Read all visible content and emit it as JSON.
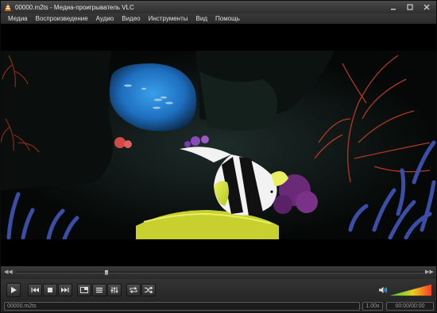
{
  "window": {
    "title": "00000.m2ts - Медиа-проигрыватель VLC",
    "controls": {
      "minimize_icon": "minimize-icon",
      "maximize_icon": "maximize-icon",
      "close_icon": "close-icon"
    }
  },
  "menu": {
    "items": [
      "Медиа",
      "Воспроизведение",
      "Аудио",
      "Видео",
      "Инструменты",
      "Вид",
      "Помощь"
    ]
  },
  "video": {
    "description_icon": "video-frame"
  },
  "seek": {
    "position": 0.22
  },
  "controls": {
    "buttons": [
      {
        "name": "play",
        "icon": "play-icon"
      },
      {
        "name": "previous",
        "icon": "previous-icon"
      },
      {
        "name": "stop",
        "icon": "stop-icon"
      },
      {
        "name": "next",
        "icon": "next-icon"
      },
      {
        "name": "fullscreen",
        "icon": "fullscreen-icon"
      },
      {
        "name": "playlist",
        "icon": "playlist-icon"
      },
      {
        "name": "extended-settings",
        "icon": "equalizer-icon"
      },
      {
        "name": "loop",
        "icon": "loop-icon"
      },
      {
        "name": "random",
        "icon": "shuffle-icon"
      }
    ],
    "volume_level": 1.0
  },
  "status": {
    "filename": "00000.m2ts",
    "speed": "1.00x",
    "time": "00:00/00:00"
  },
  "colors": {
    "accent": "#2e7fd6",
    "background": "#2b2b2b",
    "volume_low": "#2ecc2e",
    "volume_high": "#ff3a1e"
  }
}
